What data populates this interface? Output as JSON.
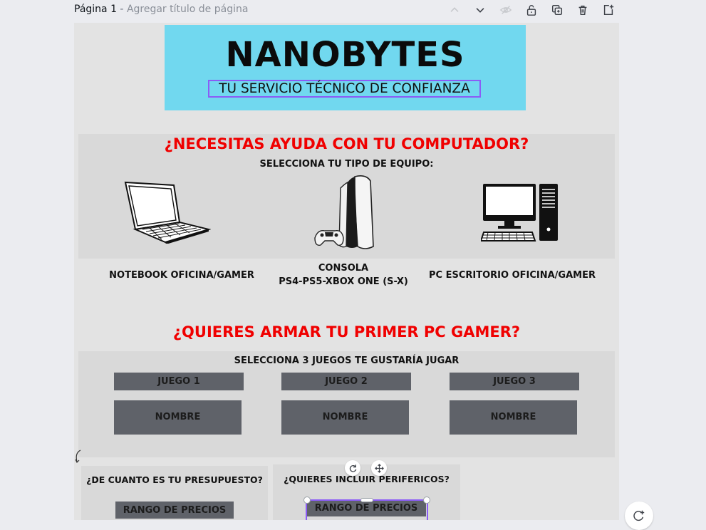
{
  "toolbar": {
    "page_number_label": "Página 1",
    "separator": " - ",
    "add_title_placeholder": "Agregar título de página",
    "icons": [
      "chevron-up-icon",
      "chevron-down-icon",
      "eye-off-icon",
      "unlock-icon",
      "duplicate-icon",
      "trash-icon",
      "add-page-icon"
    ]
  },
  "header": {
    "brand": "NANOBYTES",
    "tagline": "TU SERVICIO TÉCNICO DE CONFIANZA",
    "background_color": "#71d8ef"
  },
  "help_section": {
    "title": "¿NECESITAS AYUDA CON TU COMPUTADOR?",
    "subtitle": "SELECCIONA TU TIPO DE EQUIPO:",
    "devices": [
      {
        "icon": "laptop-icon",
        "label": "NOTEBOOK OFICINA/GAMER"
      },
      {
        "icon": "console-icon",
        "label_line1": "CONSOLA",
        "label_line2": "PS4-PS5-XBOX ONE (S-X)"
      },
      {
        "icon": "desktop-pc-icon",
        "label": "PC ESCRITORIO OFICINA/GAMER"
      }
    ]
  },
  "gamer_section": {
    "title": "¿QUIERES ARMAR TU PRIMER PC GAMER?",
    "subtitle": "SELECCIONA 3 JUEGOS TE GUSTARÍA JUGAR",
    "games": [
      {
        "header": "JUEGO 1",
        "name": "NOMBRE"
      },
      {
        "header": "JUEGO 2",
        "name": "NOMBRE"
      },
      {
        "header": "JUEGO 3",
        "name": "NOMBRE"
      }
    ]
  },
  "bottom_cards": [
    {
      "title": "¿DE CUANTO ES TU PRESUPUESTO?",
      "button": "RANGO DE PRECIOS"
    },
    {
      "title": "¿QUIERES INCLUIR PERIFERICOS?",
      "button": "RANGO DE PRECIOS"
    }
  ],
  "colors": {
    "accent_red": "#f00000",
    "selection_purple": "#8b5cf6",
    "button_gray": "#5f6269",
    "panel_gray": "#d9d9d9"
  }
}
